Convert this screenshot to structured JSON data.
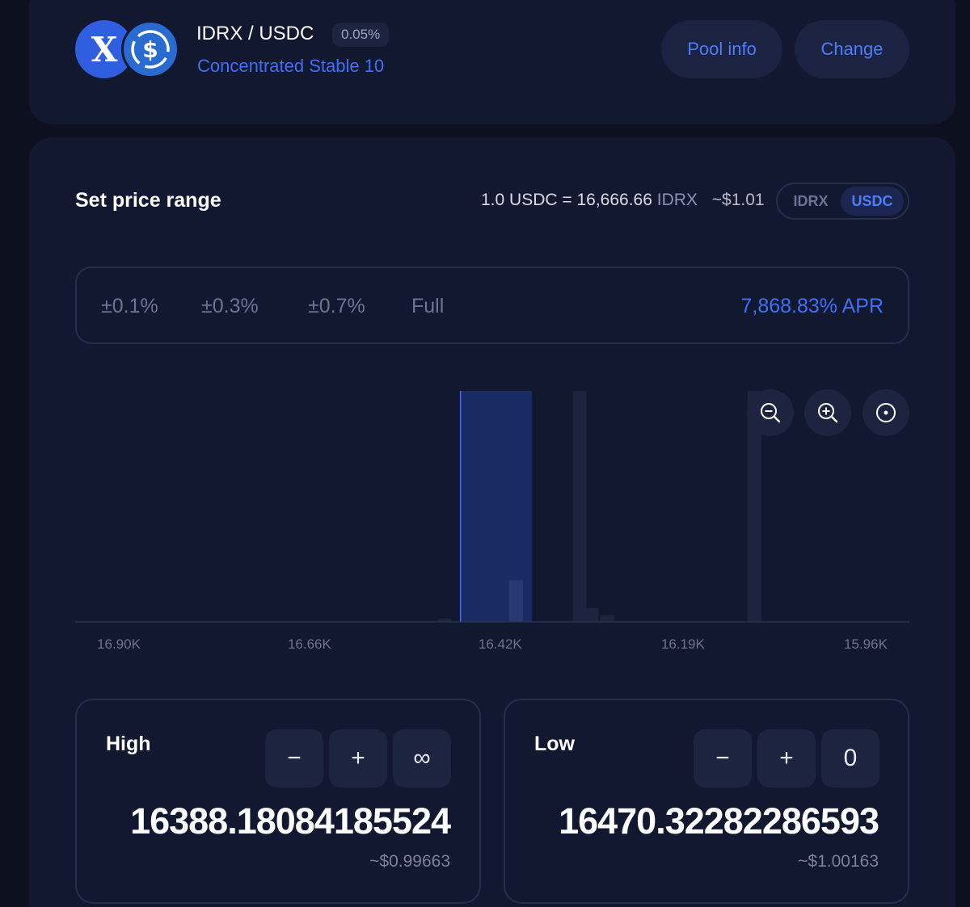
{
  "pool": {
    "pair": "IDRX / USDC",
    "fee": "0.05%",
    "type": "Concentrated Stable 10",
    "token_a_icon": "x-letter-icon",
    "token_b_icon": "dollar-coin-icon",
    "pool_info_label": "Pool info",
    "change_label": "Change"
  },
  "range": {
    "title": "Set price range",
    "rate_base": "1.0 USDC = 16,666.66",
    "rate_unit": "IDRX",
    "rate_usd": "~$1.01",
    "toggle": {
      "idrx": "IDRX",
      "usdc": "USDC",
      "selected": "USDC"
    },
    "presets": [
      "±0.1%",
      "±0.3%",
      "±0.7%",
      "Full"
    ],
    "apr": "7,868.83% APR"
  },
  "chart_data": {
    "type": "bar",
    "x_reversed": true,
    "xlim": [
      16.05,
      16.95
    ],
    "x_ticks": [
      {
        "value": 16.9,
        "label": "16.90K"
      },
      {
        "value": 16.66,
        "label": "16.66K"
      },
      {
        "value": 16.42,
        "label": "16.42K"
      },
      {
        "value": 16.19,
        "label": "16.19K"
      },
      {
        "value": 15.96,
        "label": "15.96K"
      }
    ],
    "ylim": [
      0,
      100
    ],
    "liquidity_bars": [
      {
        "x": 16.49,
        "value": 1.5
      },
      {
        "x": 16.4,
        "value": 18
      },
      {
        "x": 16.32,
        "value": 100
      },
      {
        "x": 16.305,
        "value": 6
      },
      {
        "x": 16.285,
        "value": 3
      },
      {
        "x": 16.1,
        "value": 100
      }
    ],
    "selected_range": {
      "from": 16.47,
      "to": 16.38
    },
    "colors": {
      "bar": "#1e2440",
      "selected_fill": "#1a2a62",
      "selected_edge": "#3f6ff2",
      "axis": "#2a3150",
      "tick": "#6d7491"
    }
  },
  "zoom": {
    "out_icon": "zoom-out-icon",
    "in_icon": "zoom-in-icon",
    "reset_icon": "recenter-icon"
  },
  "high": {
    "label": "High",
    "minus": "−",
    "plus": "+",
    "extra": "∞",
    "value": "16388.18084185524",
    "usd": "~$0.99663"
  },
  "low": {
    "label": "Low",
    "minus": "−",
    "plus": "+",
    "extra": "0",
    "value": "16470.32282286593",
    "usd": "~$1.00163"
  },
  "colors": {
    "accent": "#3f6ff2",
    "card": "#121830",
    "background": "#0c101f"
  }
}
